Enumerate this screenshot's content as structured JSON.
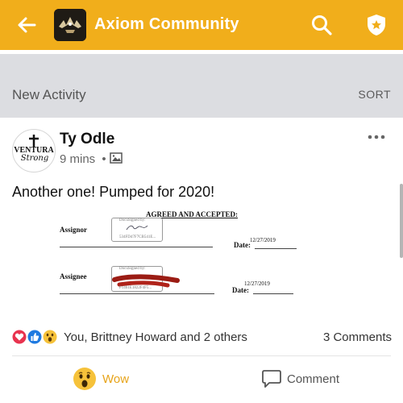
{
  "app_bar": {
    "title": "Axiom Community",
    "color": "#f1ae1b"
  },
  "feed": {
    "header": "New Activity",
    "sort_label": "SORT"
  },
  "post": {
    "author": "Ty Odle",
    "avatar_text": "VENTURA Strong",
    "time": "9 mins",
    "meta_separator": "•",
    "body": "Another one! Pumped for 2020!",
    "document": {
      "heading": "AGREED AND ACCEPTED:",
      "assignor_label": "Assignor",
      "assignee_label": "Assignee",
      "docusigned_by": "DocuSigned by:",
      "assignor_sig_id": "534FD47F7CB541E...",
      "assignee_sig_id": "F1461E1822F4F5...",
      "date_label": "Date:",
      "date_1": "12/27/2019",
      "date_2": "12/27/2019"
    },
    "reactions_text": "You, Brittney Howard and 2 others",
    "comments_count": "3 Comments",
    "actions": {
      "wow_label": "Wow",
      "comment_label": "Comment"
    }
  },
  "icons": {
    "back": "arrow-left-icon",
    "search": "search-icon",
    "shield": "shield-star-icon",
    "more": "more-dots-icon",
    "photo": "image-icon",
    "reactions": [
      "love-icon",
      "like-icon",
      "wow-icon"
    ],
    "wow": "wow-face-icon",
    "comment": "comment-bubble-icon"
  },
  "colors": {
    "accent": "#f1ae1b",
    "activity_bar": "#dcdde1",
    "like_blue": "#1f7ae0",
    "love_red": "#e8334f",
    "wow_yellow": "#f6c23a"
  }
}
